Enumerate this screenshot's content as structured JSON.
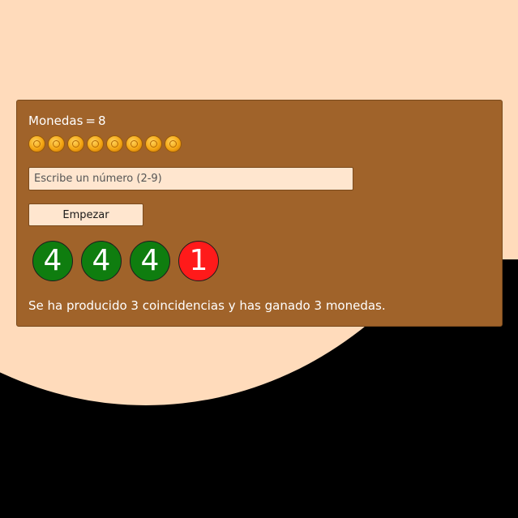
{
  "coins": {
    "label": "Monedas",
    "equals": "=",
    "count": "8",
    "icons": [
      "coin-icon",
      "coin-icon",
      "coin-icon",
      "coin-icon",
      "coin-icon",
      "coin-icon",
      "coin-icon",
      "coin-icon"
    ]
  },
  "input": {
    "value": "",
    "placeholder": "Escribe un número (2-9)"
  },
  "start_button": {
    "label": "Empezar"
  },
  "balls": [
    {
      "value": "4",
      "color": "#0f7d0f",
      "status": "match"
    },
    {
      "value": "4",
      "color": "#0f7d0f",
      "status": "match"
    },
    {
      "value": "4",
      "color": "#0f7d0f",
      "status": "match"
    },
    {
      "value": "1",
      "color": "#ff1a1a",
      "status": "no-match"
    }
  ],
  "result_message": "Se ha producido 3 coincidencias y has ganado 3 monedas.",
  "colors": {
    "background_light": "#ffdbbb",
    "background_dark": "#000000",
    "panel": "#a0632a",
    "match": "#0f7d0f",
    "no_match": "#ff1a1a"
  }
}
